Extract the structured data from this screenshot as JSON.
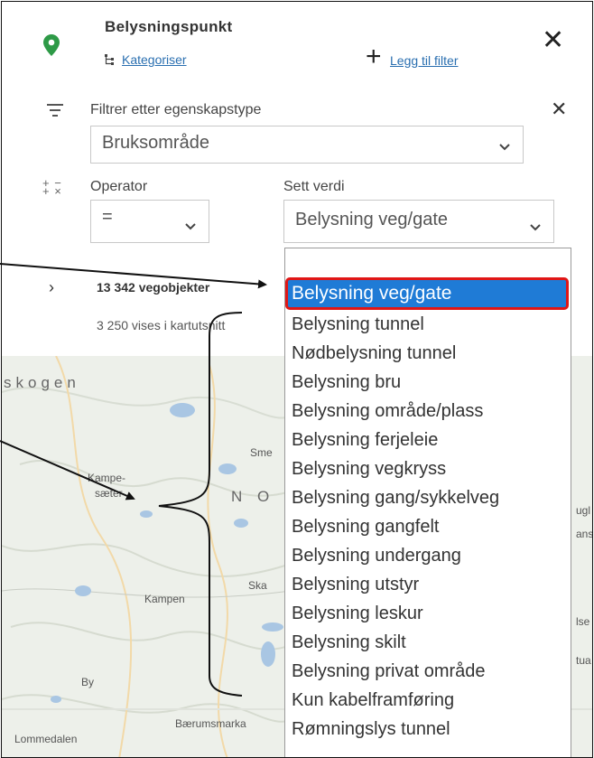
{
  "panel": {
    "title": "Belysningspunkt",
    "categorize_label": "Kategoriser",
    "add_filter_label": "Legg til filter",
    "filter_label": "Filtrer etter egenskapstype",
    "property_select_value": "Bruksområde",
    "operator_label": "Operator",
    "operator_value": "=",
    "value_label": "Sett verdi",
    "value_select_value": "Belysning veg/gate",
    "result_count": "13 342 vegobjekter",
    "shown_count": "3 250 vises i kartutsnitt"
  },
  "map": {
    "labels": [
      "skogen",
      "Kampe-",
      "sæter",
      "Sme",
      "N O",
      "Ska",
      "Kampen",
      "By",
      "Bærumsmarka",
      "Lommedalen",
      "ugl",
      "ans",
      "lse",
      "tua"
    ]
  },
  "dropdown": {
    "options": [
      "Belysning veg/gate",
      "Belysning tunnel",
      "Nødbelysning tunnel",
      "Belysning bru",
      "Belysning område/plass",
      "Belysning ferjeleie",
      "Belysning vegkryss",
      "Belysning gang/sykkelveg",
      "Belysning gangfelt",
      "Belysning undergang",
      "Belysning utstyr",
      "Belysning leskur",
      "Belysning skilt",
      "Belysning privat område",
      "Kun kabelframføring",
      "Rømningslys tunnel"
    ]
  },
  "colors": {
    "accent_green": "#2e9a47",
    "link_blue": "#2a6fb0",
    "selection_blue": "#1f7bd6",
    "highlight_red": "#e01616"
  },
  "icons": {
    "pin": "map-pin-icon",
    "categorize": "hierarchy-icon",
    "add": "plus-icon",
    "close": "close-icon",
    "filter": "filter-icon",
    "operator": "plus-minus-times-icon",
    "chevron": "chevron-down-icon",
    "expand": "chevron-right-icon"
  }
}
